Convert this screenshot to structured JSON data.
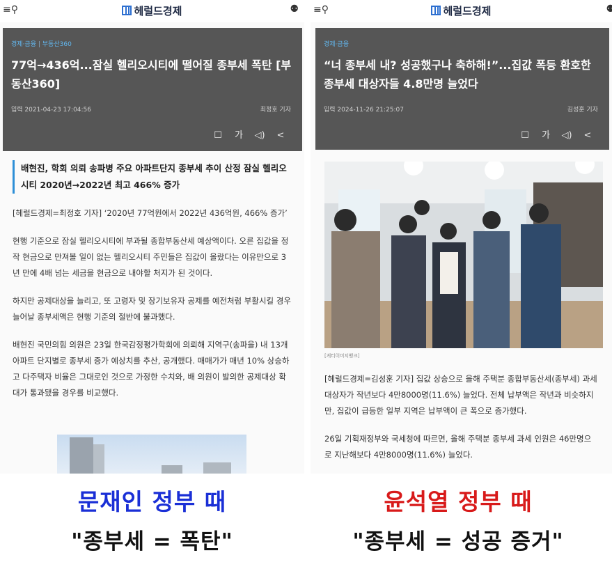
{
  "left": {
    "logo": "헤럴드경제",
    "category": "경제·금융",
    "category_sub": "부동산360",
    "headline": "77억→436억...잠실 헬리오시티에 떨어질 종부세 폭탄 [부동산360]",
    "date": "입력 2021-04-23 17:04:56",
    "reporter": "최정호 기자",
    "subhead": "배현진, 학회 의뢰 송파병 주요 아파트단지 종부세 추이 산정 잠실 헬리오시티 2020년→2022년 최고 466% 증가",
    "paragraphs": [
      "[헤럴드경제=최정호 기자] ‘2020년 77억원에서 2022년 436억원, 466% 증가’",
      "현행 기준으로 잠실 헬리오시티에 부과될 종합부동산세 예상액이다. 오른 집값을 정작 현금으로 만져볼 일이 없는 헬리오시티 주민들은 집값이 올랐다는 이유만으로 3년 만에 4배 넘는 세금을 현금으로 내야할 처지가 된 것이다.",
      "하지만 공제대상을 늘리고, 또 고령자 및 장기보유자 공제를 예전처럼 부활시킬 경우 늘어날 종부세액은 현행 기준의 절반에 불과했다.",
      "배현진 국민의힘 의원은 23일 한국감정평가학회에 의뢰해 지역구(송파을) 내 13개 아파트 단지별로 종부세 증가 예상치를 추산, 공개했다. 매매가가 매년 10% 상승하고 다주택자 비율은 그대로인 것으로 가정한 수치와, 배 의원이 발의한 공제대상 확대가 통과됐을 경우를 비교했다."
    ]
  },
  "right": {
    "logo": "헤럴드경제",
    "category": "경제·금융",
    "headline": "“너 종부세 내? 성공했구나 축하해!”...집값 폭등 환호한 종부세 대상자들 4.8만명 늘었다",
    "date": "입력 2024-11-26 21:25:07",
    "reporter": "김성훈 기자",
    "photo_caption": "[게티이미지뱅크]",
    "paragraphs": [
      "[헤럴드경제=김성훈 기자] 집값 상승으로 올해 주택분 종합부동산세(종부세) 과세 대상자가 작년보다 4만8000명(11.6%) 늘었다. 전체 납부액은 작년과 비슷하지만, 집값이 급등한 일부 지역은 납부액이 큰 폭으로 증가했다.",
      "26일 기획재정부와 국세청에 따르면, 올해 주택분 종부세 과세 인원은 46만명으로 지난해보다 4만8000명(11.6%) 늘었다."
    ]
  },
  "tools": {
    "bookmark": "☐",
    "font": "가",
    "audio": "◁)",
    "share": "<"
  },
  "bottom": {
    "left_gov": "문재인 정부 때",
    "left_slogan": "\"종부세 = 폭탄\"",
    "right_gov": "윤석열 정부 때",
    "right_slogan": "\"종부세 = 성공 증거\""
  },
  "colors": {
    "header_bg": "#565656",
    "accent_blue": "#1a2fd6",
    "accent_red": "#d81a1a",
    "subhead_bar": "#2d8fd7"
  }
}
